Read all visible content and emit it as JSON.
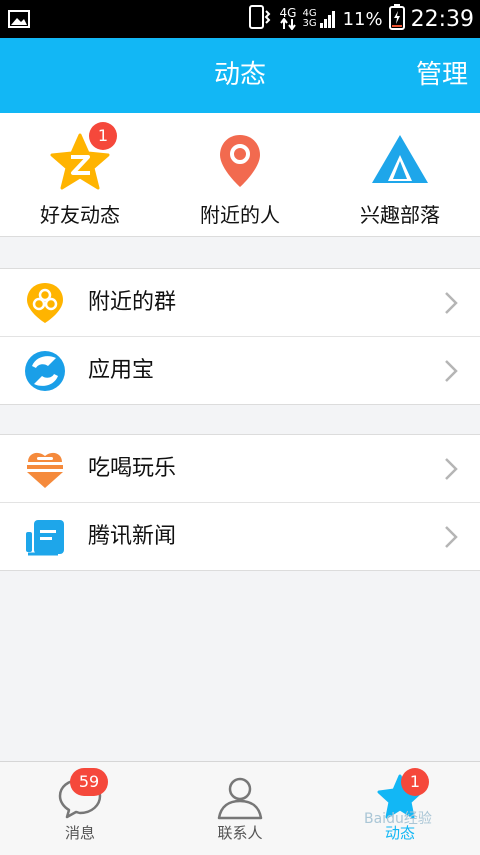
{
  "status_bar": {
    "network_top": "4G",
    "network_small_top": "4G",
    "network_small_bottom": "3G",
    "battery": "11%",
    "time": "22:39"
  },
  "header": {
    "title": "动态",
    "manage": "管理"
  },
  "quick_actions": [
    {
      "label": "好友动态",
      "icon": "qzone-star-icon",
      "badge": "1"
    },
    {
      "label": "附近的人",
      "icon": "location-pin-icon"
    },
    {
      "label": "兴趣部落",
      "icon": "tent-icon"
    }
  ],
  "groups": [
    {
      "items": [
        {
          "label": "附近的群",
          "icon": "nearby-group-icon"
        },
        {
          "label": "应用宝",
          "icon": "app-store-icon"
        }
      ]
    },
    {
      "items": [
        {
          "label": "吃喝玩乐",
          "icon": "food-icon"
        },
        {
          "label": "腾讯新闻",
          "icon": "news-icon"
        }
      ]
    }
  ],
  "tabs": [
    {
      "label": "消息",
      "icon": "message-bubble-icon",
      "badge": "59"
    },
    {
      "label": "联系人",
      "icon": "contact-person-icon"
    },
    {
      "label": "动态",
      "icon": "star-icon",
      "badge": "1",
      "active": true
    }
  ],
  "watermark": "Baidu经验",
  "colors": {
    "brand": "#12b7f5",
    "badge": "#f5483b",
    "star": "#ffb400",
    "pin": "#f26a4f"
  }
}
